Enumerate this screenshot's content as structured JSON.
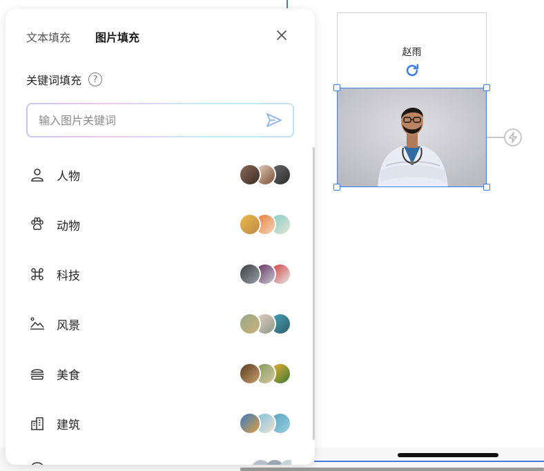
{
  "panel": {
    "tabs": [
      {
        "label": "文本填充",
        "active": false
      },
      {
        "label": "图片填充",
        "active": true
      }
    ],
    "section_title": "关键词填充",
    "help_icon": "?",
    "search": {
      "placeholder": "输入图片关键词",
      "value": ""
    },
    "categories": [
      {
        "label": "人物",
        "icon": "person-icon",
        "thumb_colors": [
          [
            "#8c6b5a",
            "#3b2b22"
          ],
          [
            "#e8d2c2",
            "#7a4e34"
          ],
          [
            "#6a6a6a",
            "#2b2b2b"
          ]
        ]
      },
      {
        "label": "动物",
        "icon": "paw-icon",
        "thumb_colors": [
          [
            "#f0b84a",
            "#b98a46"
          ],
          [
            "#e87a3a",
            "#f3d6b8"
          ],
          [
            "#7fd0c8",
            "#e7e1d4"
          ]
        ]
      },
      {
        "label": "科技",
        "icon": "command-icon",
        "thumb_colors": [
          [
            "#3c3f46",
            "#9aa0a8"
          ],
          [
            "#5a2a5a",
            "#c9c9d2"
          ],
          [
            "#d03a3a",
            "#e6e6e6"
          ]
        ]
      },
      {
        "label": "风景",
        "icon": "landscape-icon",
        "thumb_colors": [
          [
            "#9aa889",
            "#c9b27a"
          ],
          [
            "#e2cfbf",
            "#8e9a8a"
          ],
          [
            "#4aa3b8",
            "#2f5d6a"
          ]
        ]
      },
      {
        "label": "美食",
        "icon": "burger-icon",
        "thumb_colors": [
          [
            "#5a3b22",
            "#c8a06a"
          ],
          [
            "#7a9a55",
            "#d8c6a2"
          ],
          [
            "#f0b030",
            "#3a7a3a"
          ]
        ]
      },
      {
        "label": "建筑",
        "icon": "building-icon",
        "thumb_colors": [
          [
            "#3a7ac0",
            "#e0a040"
          ],
          [
            "#7ac0e0",
            "#f0e0d0"
          ],
          [
            "#5aa0c0",
            "#9ad0e0"
          ]
        ]
      }
    ]
  },
  "canvas": {
    "card_name": "赵雨"
  },
  "colors": {
    "accent": "#3f7be8"
  }
}
